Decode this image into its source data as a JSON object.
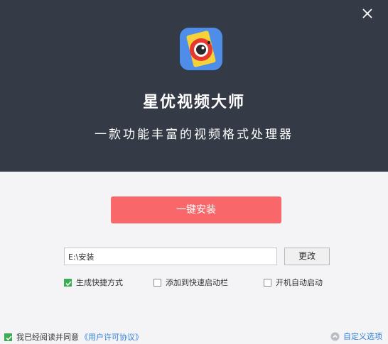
{
  "app": {
    "title": "星优视频大师",
    "subtitle": "一款功能丰富的视频格式处理器"
  },
  "install": {
    "button_label": "一键安装"
  },
  "path": {
    "value": "E:\\安装",
    "change_label": "更改"
  },
  "options": [
    {
      "label": "生成快捷方式",
      "checked": true
    },
    {
      "label": "添加到快速启动栏",
      "checked": false
    },
    {
      "label": "开机自动启动",
      "checked": false
    }
  ],
  "footer": {
    "agree_text": "我已经阅读并同意",
    "license_link": "《用户许可协议》",
    "agree_checked": true,
    "custom_options": "自定义选项"
  },
  "colors": {
    "header_bg": "#343a46",
    "accent": "#f8686a",
    "checkbox_green": "#3cae52",
    "link_blue": "#2f7ed8"
  },
  "icons": {
    "close": "close-icon",
    "logo": "app-logo-icon",
    "custom_options": "chevron-up-circle-icon",
    "check": "check-icon"
  }
}
